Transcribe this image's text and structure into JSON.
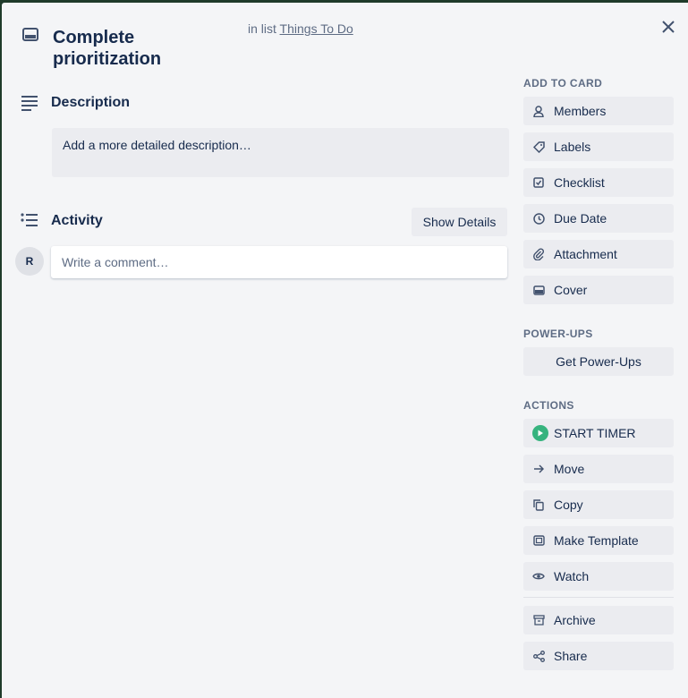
{
  "card": {
    "title": "Complete prioritization",
    "in_list_prefix": "in list",
    "list_name": "Things To Do"
  },
  "description": {
    "heading": "Description",
    "placeholder": "Add a more detailed description…"
  },
  "activity": {
    "heading": "Activity",
    "show_details": "Show Details",
    "avatar_initial": "R",
    "comment_placeholder": "Write a comment…"
  },
  "sidebar": {
    "add_to_card": {
      "heading": "ADD TO CARD",
      "items": [
        {
          "label": "Members",
          "icon": "person-icon"
        },
        {
          "label": "Labels",
          "icon": "tag-icon"
        },
        {
          "label": "Checklist",
          "icon": "checkbox-icon"
        },
        {
          "label": "Due Date",
          "icon": "clock-icon"
        },
        {
          "label": "Attachment",
          "icon": "paperclip-icon"
        },
        {
          "label": "Cover",
          "icon": "card-icon"
        }
      ]
    },
    "power_ups": {
      "heading": "POWER-UPS",
      "get_label": "Get Power-Ups"
    },
    "actions": {
      "heading": "ACTIONS",
      "timer_label": "START TIMER",
      "items": [
        {
          "label": "Move",
          "icon": "arrow-right-icon"
        },
        {
          "label": "Copy",
          "icon": "copy-icon"
        },
        {
          "label": "Make Template",
          "icon": "template-icon"
        },
        {
          "label": "Watch",
          "icon": "eye-icon"
        }
      ],
      "items2": [
        {
          "label": "Archive",
          "icon": "archive-icon"
        },
        {
          "label": "Share",
          "icon": "share-icon"
        }
      ]
    }
  },
  "colors": {
    "timer_green": "#36b37e",
    "panel_bg": "#f4f5f7",
    "button_bg": "#ebecf0"
  }
}
